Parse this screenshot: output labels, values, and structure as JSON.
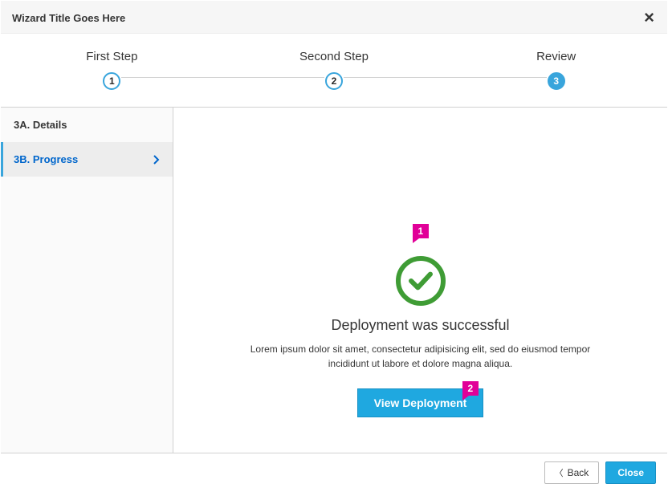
{
  "header": {
    "title": "Wizard Title Goes Here"
  },
  "steps": [
    {
      "label": "First Step",
      "num": "1",
      "filled": false
    },
    {
      "label": "Second Step",
      "num": "2",
      "filled": false
    },
    {
      "label": "Review",
      "num": "3",
      "filled": true
    }
  ],
  "sidebar": {
    "items": [
      {
        "label": "3A. Details",
        "active": false
      },
      {
        "label": "3B. Progress",
        "active": true
      }
    ]
  },
  "result": {
    "title": "Deployment was successful",
    "description": "Lorem ipsum dolor sit amet, consectetur adipisicing elit, sed do eiusmod tempor incididunt ut labore et dolore magna aliqua.",
    "action_label": "View  Deployment"
  },
  "callouts": {
    "a": "1",
    "b": "2"
  },
  "footer": {
    "back": "Back",
    "close": "Close"
  },
  "colors": {
    "accent": "#1fa8e0",
    "success": "#3f9c35",
    "callout": "#e10098"
  }
}
